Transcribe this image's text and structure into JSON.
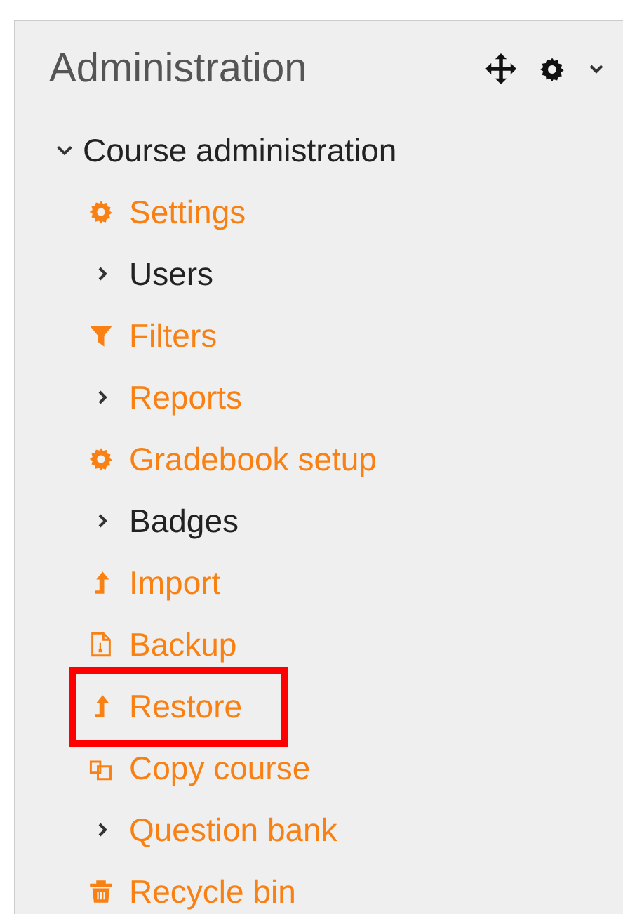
{
  "block": {
    "title": "Administration",
    "node": {
      "label": "Course administration",
      "expanded": true,
      "children": [
        {
          "label": "Settings",
          "kind": "gear",
          "link": true,
          "highlighted": false
        },
        {
          "label": "Users",
          "kind": "branch",
          "link": false,
          "highlighted": false
        },
        {
          "label": "Filters",
          "kind": "filter",
          "link": true,
          "highlighted": false
        },
        {
          "label": "Reports",
          "kind": "branch",
          "link": true,
          "highlighted": false
        },
        {
          "label": "Gradebook setup",
          "kind": "gear",
          "link": true,
          "highlighted": false
        },
        {
          "label": "Badges",
          "kind": "branch",
          "link": false,
          "highlighted": false
        },
        {
          "label": "Import",
          "kind": "upload",
          "link": true,
          "highlighted": false
        },
        {
          "label": "Backup",
          "kind": "file",
          "link": true,
          "highlighted": false
        },
        {
          "label": "Restore",
          "kind": "upload",
          "link": true,
          "highlighted": true
        },
        {
          "label": "Copy course",
          "kind": "copy",
          "link": true,
          "highlighted": false
        },
        {
          "label": "Question bank",
          "kind": "branch",
          "link": true,
          "highlighted": false
        },
        {
          "label": "Recycle bin",
          "kind": "trash",
          "link": true,
          "highlighted": false
        }
      ]
    }
  }
}
